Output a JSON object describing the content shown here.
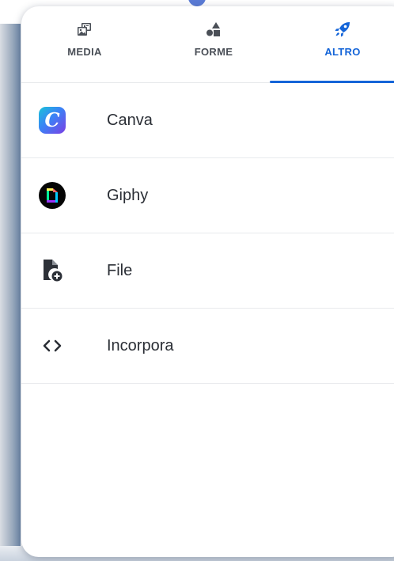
{
  "tabs": [
    {
      "label": "MEDIA",
      "icon": "media-icon",
      "active": false
    },
    {
      "label": "FORME",
      "icon": "shapes-icon",
      "active": false
    },
    {
      "label": "ALTRO",
      "icon": "rocket-icon",
      "active": true
    }
  ],
  "items": [
    {
      "label": "Canva",
      "icon": "canva-icon"
    },
    {
      "label": "Giphy",
      "icon": "giphy-icon"
    },
    {
      "label": "File",
      "icon": "file-add-icon"
    },
    {
      "label": "Incorpora",
      "icon": "code-icon"
    }
  ],
  "colors": {
    "accent": "#1565d8",
    "text": "#2a2e35",
    "tab_text": "#4a4f57",
    "divider": "#e8eaed"
  }
}
